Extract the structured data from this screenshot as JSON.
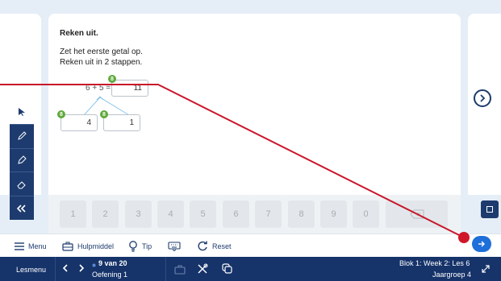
{
  "question": {
    "title": "Reken uit.",
    "line1": "Zet het eerste getal op.",
    "line2": "Reken uit in 2 stappen.",
    "equation": "6 + 5 =",
    "answer": "11",
    "split_left": "4",
    "split_right": "1",
    "badge_label": "8"
  },
  "keypad": {
    "keys": [
      "1",
      "2",
      "3",
      "4",
      "5",
      "6",
      "7",
      "8",
      "9",
      "0"
    ],
    "backspace_icon": "backspace-icon"
  },
  "toolbar": {
    "menu_label": "Menu",
    "hulpmiddel_label": "Hulpmiddel",
    "tip_label": "Tip",
    "reset_label": "Reset"
  },
  "statusbar": {
    "lesmenu_label": "Lesmenu",
    "progress": "9 van 20",
    "exercise": "Oefening 1",
    "blok": "Blok 1: Week 2: Les 6",
    "jaargroep": "Jaargroep 4"
  },
  "colors": {
    "navy": "#1d3b6e",
    "accent_blue": "#1e6fd9",
    "badge_green": "#5fa93b",
    "annotation_red": "#d0172a"
  }
}
